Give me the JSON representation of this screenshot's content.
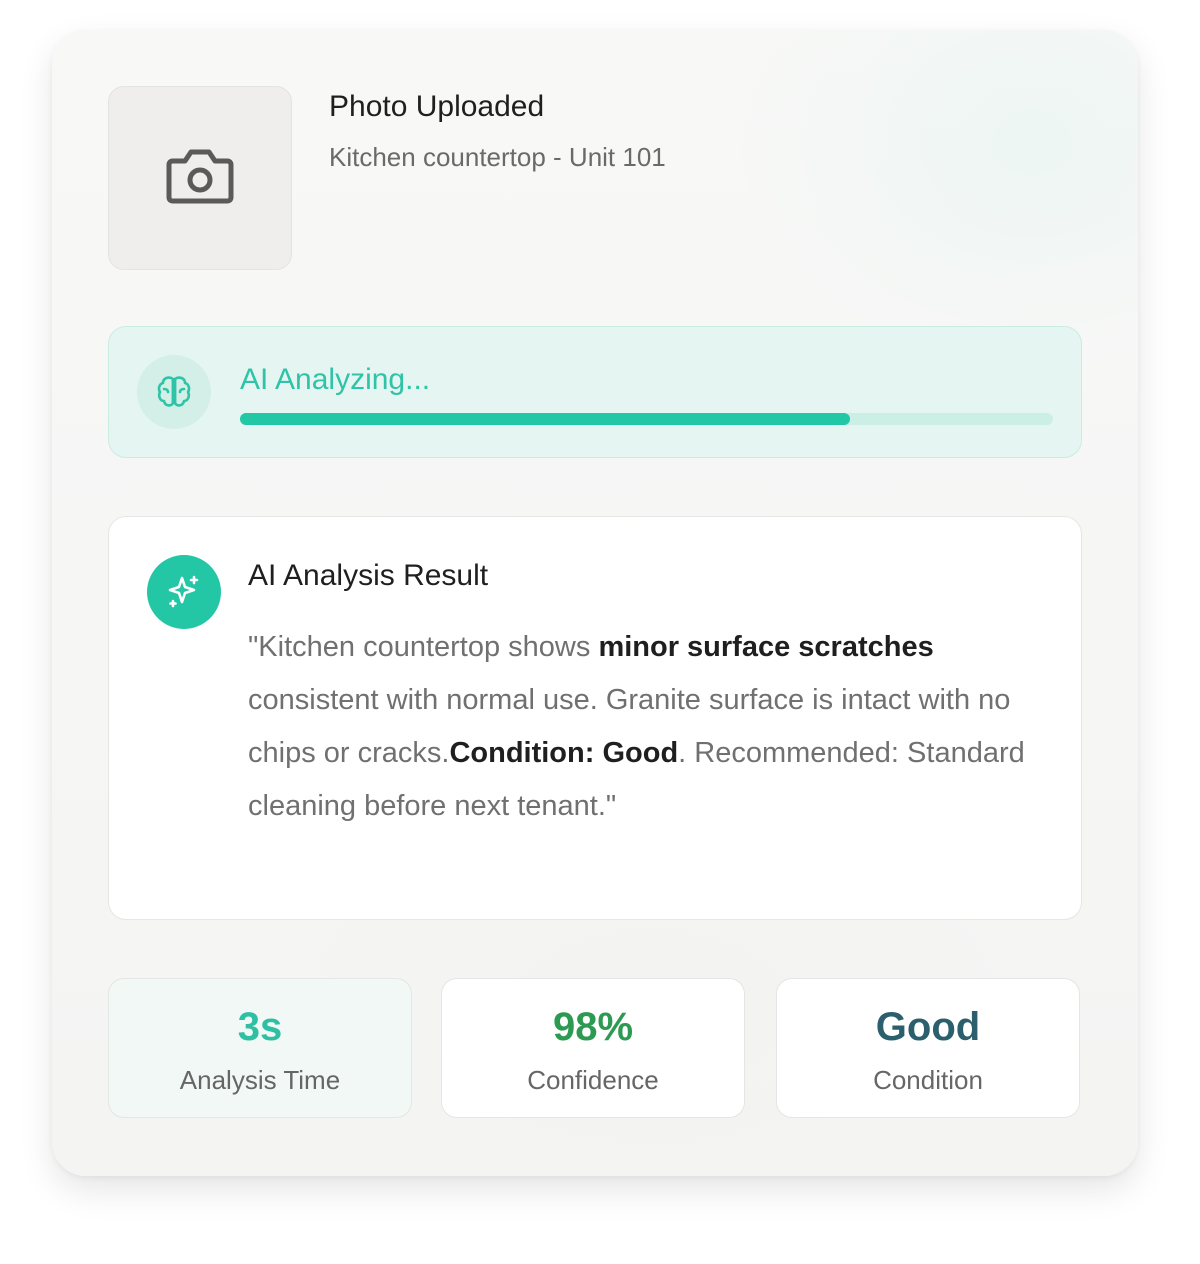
{
  "upload": {
    "icon": "camera-icon",
    "title": "Photo Uploaded",
    "subtitle": "Kitchen countertop - Unit 101"
  },
  "analyzing": {
    "icon": "brain-icon",
    "label": "AI Analyzing...",
    "progress": 0.75,
    "color": "#22c7a6"
  },
  "result": {
    "icon": "sparkle-icon",
    "title": "AI Analysis Result",
    "text_parts": [
      {
        "text": "\"Kitchen countertop shows ",
        "bold": false
      },
      {
        "text": "minor surface scratches",
        "bold": true
      },
      {
        "text": " consistent with normal use. Granite surface is intact with no chips or cracks.",
        "bold": false
      },
      {
        "text": "Condition: Good",
        "bold": true
      },
      {
        "text": ". Recommended: Standard cleaning before next tenant.\"",
        "bold": false
      }
    ]
  },
  "stats": [
    {
      "value": "3s",
      "label": "Analysis Time",
      "color": "#2fbfa3"
    },
    {
      "value": "98%",
      "label": "Confidence",
      "color": "#2d9a52"
    },
    {
      "value": "Good",
      "label": "Condition",
      "color": "#2c5f6e"
    }
  ]
}
